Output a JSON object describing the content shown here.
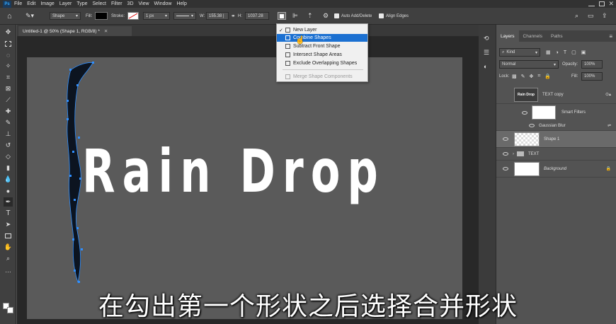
{
  "menubar": {
    "app_icon": "Ps",
    "items": [
      "File",
      "Edit",
      "Image",
      "Layer",
      "Type",
      "Select",
      "Filter",
      "3D",
      "View",
      "Window",
      "Help"
    ]
  },
  "options": {
    "mode": "Shape",
    "fill_label": "Fill:",
    "stroke_label": "Stroke:",
    "stroke_size": "1 px",
    "w_label": "W:",
    "w_value": "155.38 |",
    "h_label": "H:",
    "h_value": "1037.28",
    "auto_add_delete": "Auto Add/Delete",
    "align_edges": "Align Edges"
  },
  "doc_tab": {
    "title": "Untitled-1 @ 50% (Shape 1, RGB/8) *"
  },
  "canvas": {
    "title_text": "Rain Drop"
  },
  "shape_menu": {
    "items": [
      {
        "label": "New Layer",
        "state": "checked"
      },
      {
        "label": "Combine Shapes",
        "state": "selected"
      },
      {
        "label": "Subtract Front Shape",
        "state": "normal"
      },
      {
        "label": "Intersect Shape Areas",
        "state": "normal"
      },
      {
        "label": "Exclude Overlapping Shapes",
        "state": "normal"
      },
      {
        "label": "Merge Shape Components",
        "state": "disabled"
      }
    ]
  },
  "layers_panel": {
    "tabs": [
      "Layers",
      "Channels",
      "Paths"
    ],
    "filter_kind": "Kind",
    "blend_mode": "Normal",
    "opacity_label": "Opacity:",
    "opacity_value": "100%",
    "lock_label": "Lock:",
    "fill_label": "Fill:",
    "fill_value": "100%",
    "layers": [
      {
        "name": "TEXT copy",
        "thumb_text": "Rain Drop"
      },
      {
        "name": "Smart Filters"
      },
      {
        "name": "Gaussian Blur"
      },
      {
        "name": "Shape 1"
      },
      {
        "name": "TEXT"
      },
      {
        "name": "Background"
      }
    ]
  },
  "subtitle": "在勾出第一个形状之后选择合并形状",
  "colors": {
    "accent": "#1b70d1",
    "anchor": "#2f8fff",
    "shape_fill": "#0c1420"
  }
}
